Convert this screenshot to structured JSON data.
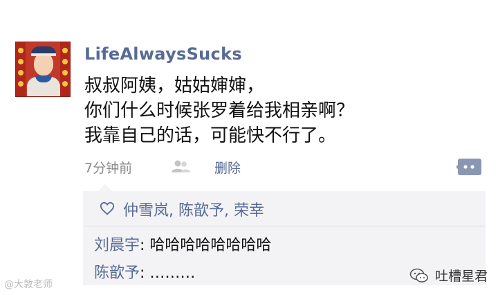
{
  "post": {
    "username": "LifeAlwaysSucks",
    "lines": [
      "叔叔阿姨，姑姑婶婶，",
      "你们什么时候张罗着给我相亲啊？",
      "我靠自己的话，可能快不行了。"
    ],
    "time": "7分钟前",
    "delete_label": "删除",
    "avatar_icon": "boy-in-traditional-costume-avatar"
  },
  "interactions": {
    "likes": "仲雪岚, 陈歆予, 荣幸",
    "comments": [
      {
        "name": "刘晨宇",
        "separator": ": ",
        "text": "哈哈哈哈哈哈哈哈"
      },
      {
        "name": "陈歆予",
        "separator": ": ",
        "text": "………"
      }
    ]
  },
  "watermarks": {
    "left": "@大敦老师",
    "right": "吐槽星君"
  },
  "colors": {
    "link": "#576b95",
    "text": "#111111",
    "muted": "#8a8a8a",
    "box_bg": "#f3f3f5"
  }
}
